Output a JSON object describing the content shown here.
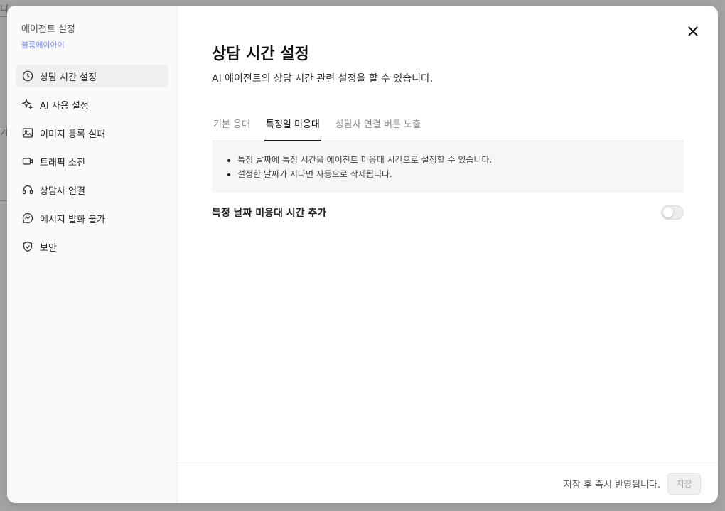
{
  "backdrop": {
    "frag1": "니",
    "frag2": "기"
  },
  "sidebar": {
    "title": "에이전트 설정",
    "subtitle": "블룸에이아이",
    "items": [
      {
        "label": "상담 시간 설정",
        "icon": "clock-icon",
        "active": true
      },
      {
        "label": "AI 사용 설정",
        "icon": "sparkle-icon",
        "active": false
      },
      {
        "label": "이미지 등록 실패",
        "icon": "image-icon",
        "active": false
      },
      {
        "label": "트래픽 소진",
        "icon": "video-icon",
        "active": false
      },
      {
        "label": "상담사 연결",
        "icon": "headset-icon",
        "active": false
      },
      {
        "label": "메시지 발화 불가",
        "icon": "chat-alert-icon",
        "active": false
      },
      {
        "label": "보안",
        "icon": "shield-icon",
        "active": false
      }
    ]
  },
  "main": {
    "title": "상담 시간 설정",
    "description": "AI 에이전트의 상담 시간 관련 설정을 할 수 있습니다.",
    "tabs": [
      {
        "label": "기본 응대",
        "active": false
      },
      {
        "label": "특정일 미응대",
        "active": true
      },
      {
        "label": "상담사 연결 버튼 노출",
        "active": false
      }
    ],
    "notice": [
      "특정 날짜에 특정 시간을 에이전트 미응대 시간으로 설정할 수 있습니다.",
      "설정한 날짜가 지나면 자동으로 삭제됩니다."
    ],
    "setting": {
      "label": "특정 날짜 미응대 시간 추가",
      "enabled": false
    }
  },
  "footer": {
    "note": "저장 후 즉시 반영됩니다.",
    "save_label": "저장"
  },
  "colors": {
    "accent": "#7b8ee8",
    "active_tab": "#111111",
    "backdrop": "#a3a3a3"
  }
}
